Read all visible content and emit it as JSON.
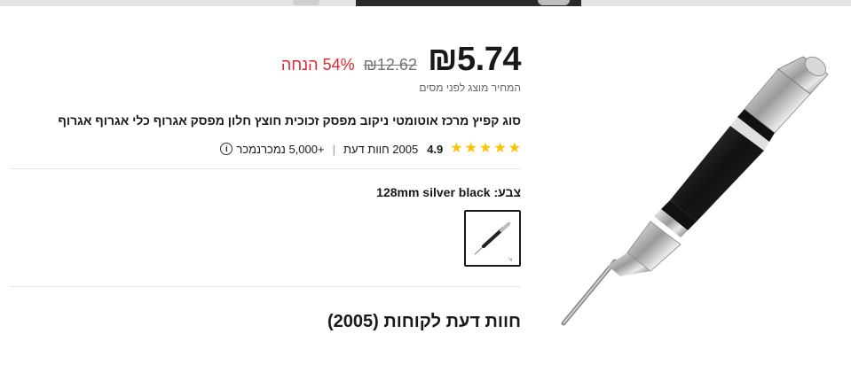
{
  "price": {
    "current": "₪5.74",
    "original": "₪12.62",
    "discount": "54% הנחה",
    "tax_note": "המחיר מוצג לפני מסים"
  },
  "product": {
    "title": "סוג קפיץ מרכז אוטומטי ניקוב מפסק זכוכית חוצץ חלון מפסק אגרוף כלי אגרוף אגרוף",
    "rating": "4.9",
    "rating_stars": 5,
    "reviews_count": "2005 חוות דעת",
    "separator": "|",
    "sold": "+5,000 נמכרנמכר",
    "info_icon": "info-icon"
  },
  "variant": {
    "label": "צבע:",
    "value": "128mm silver black"
  },
  "reviews_section": {
    "title": "חוות דעת לקוחות (2005)"
  },
  "colors": {
    "discount": "#e3262f",
    "star": "#fdc300"
  }
}
